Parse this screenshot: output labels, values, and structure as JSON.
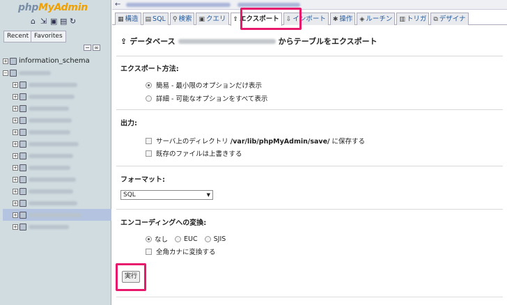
{
  "sidebar": {
    "logo_php": "php",
    "logo_myadmin": "MyAdmin",
    "tabs": {
      "recent": "Recent",
      "favorites": "Favorites"
    },
    "tree": {
      "first_db": "information_schema"
    }
  },
  "tabs": [
    {
      "label": "構造"
    },
    {
      "label": "SQL"
    },
    {
      "label": "検索"
    },
    {
      "label": "クエリ"
    },
    {
      "label": "エクスポート"
    },
    {
      "label": "インポート"
    },
    {
      "label": "操作"
    },
    {
      "label": "ルーチン"
    },
    {
      "label": "トリガ"
    },
    {
      "label": "デザイナ"
    }
  ],
  "title": {
    "prefix": "データベース",
    "suffix": "からテーブルをエクスポート"
  },
  "export_method": {
    "heading": "エクスポート方法:",
    "quick": "簡易 - 最小限のオプションだけ表示",
    "custom": "詳細 - 可能なオプションをすべて表示"
  },
  "output": {
    "heading": "出力:",
    "save_prefix": "サーバ上のディレクトリ ",
    "save_path": "/var/lib/phpMyAdmin/save/",
    "save_suffix": " に保存する",
    "overwrite": "既存のファイルは上書きする"
  },
  "format": {
    "heading": "フォーマット:",
    "selected": "SQL"
  },
  "encoding": {
    "heading": "エンコーディングへの変換:",
    "none": "なし",
    "euc": "EUC",
    "sjis": "SJIS",
    "zenkaku": "全角カナに変換する"
  },
  "execute_label": "実行",
  "colors": {
    "highlight": "#e8186d",
    "sidebar_bg": "#d0dce0",
    "link": "#235a9c"
  }
}
